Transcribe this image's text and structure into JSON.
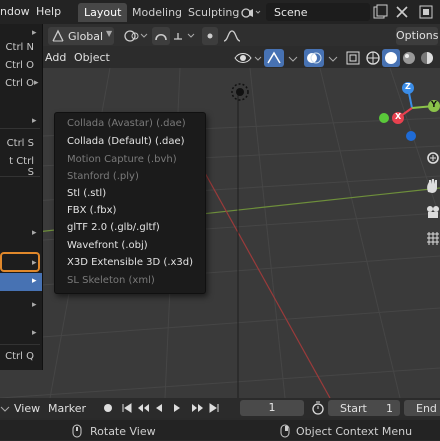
{
  "topbar": {
    "menus": [
      "ndow",
      "Help"
    ],
    "workspace_tabs": [
      "Layout",
      "Modeling",
      "Sculpting"
    ],
    "scene_name": "Scene"
  },
  "header": {
    "orientation": "Global",
    "options_label": "Options",
    "add_label": "Add",
    "object_label": "Object"
  },
  "left_menu": {
    "items": [
      {
        "shortcut": "Ctrl N",
        "arrow": true
      },
      {
        "shortcut": "Ctrl O",
        "arrow": false
      },
      {
        "shortcut": "Ctrl O",
        "arrow": true
      },
      {
        "shortcut": "",
        "arrow": true
      },
      {
        "shortcut": "Ctrl S",
        "arrow": false
      },
      {
        "shortcut": "t Ctrl S",
        "arrow": false
      },
      {
        "shortcut": "",
        "arrow": true
      },
      {
        "shortcut": "",
        "arrow": true
      },
      {
        "shortcut": "",
        "arrow": true
      },
      {
        "shortcut": "",
        "arrow": true
      },
      {
        "shortcut": "Ctrl Q",
        "arrow": false
      }
    ]
  },
  "export_menu": {
    "items": [
      {
        "label": "Collada (Avastar) (.dae)",
        "enabled": false
      },
      {
        "label": "Collada (Default) (.dae)",
        "enabled": true
      },
      {
        "label": "Motion Capture (.bvh)",
        "enabled": false
      },
      {
        "label": "Stanford (.ply)",
        "enabled": false
      },
      {
        "label": "Stl (.stl)",
        "enabled": true
      },
      {
        "label": "FBX (.fbx)",
        "enabled": true
      },
      {
        "label": "glTF 2.0 (.glb/.gltf)",
        "enabled": true
      },
      {
        "label": "Wavefront (.obj)",
        "enabled": true
      },
      {
        "label": "X3D Extensible 3D (.x3d)",
        "enabled": true
      },
      {
        "label": "SL Skeleton (xml)",
        "enabled": false
      }
    ]
  },
  "gizmo": {
    "x_label": "X",
    "y_label": "Y",
    "z_label": "Z",
    "x_color": "#e8414f",
    "y_color": "#8bc34a",
    "z_color": "#3b8de8"
  },
  "timeline": {
    "view_label": "View",
    "marker_label": "Marker",
    "current_frame": "1",
    "start_label": "Start",
    "start_value": "1",
    "end_label": "End"
  },
  "statusbar": {
    "left_action": "Rotate View",
    "right_action": "Object Context Menu"
  },
  "colors": {
    "accent_blue": "#4772b3",
    "hover_outline": "#e0882b"
  }
}
